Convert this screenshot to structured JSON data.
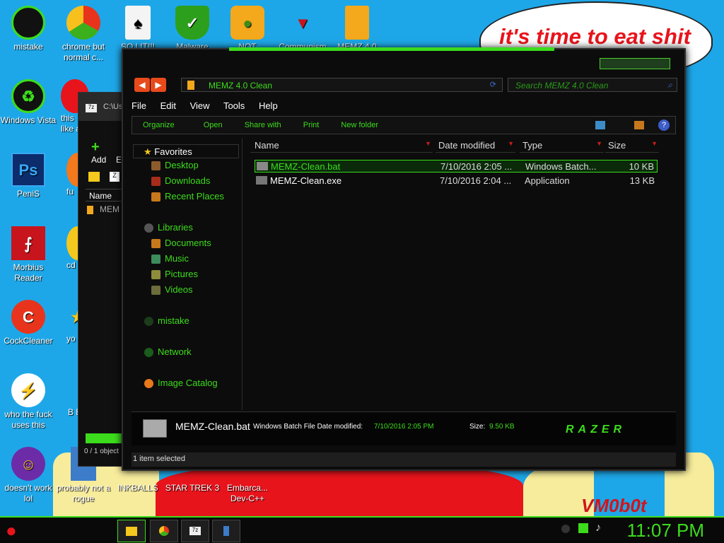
{
  "wallpaper": {
    "bubble_text": "it's time to eat shit",
    "signature": "VM0b0t"
  },
  "desktop_icons": [
    {
      "label": "mistake"
    },
    {
      "label": "chrome but normal c..."
    },
    {
      "label": "SO LIT!!!"
    },
    {
      "label": "Malware"
    },
    {
      "label": "NOT"
    },
    {
      "label": "Communism"
    },
    {
      "label": "MEMZ 4.0"
    },
    {
      "label": "Windows Vista"
    },
    {
      "label": "this like a"
    },
    {
      "label": "PeniS"
    },
    {
      "label": "fu"
    },
    {
      "label": "Morbius Reader"
    },
    {
      "label": "cd"
    },
    {
      "label": "CockCleaner"
    },
    {
      "label": "yo"
    },
    {
      "label": "who the fuck uses this"
    },
    {
      "label": "B B"
    },
    {
      "label": "doesn't work lol"
    },
    {
      "label": "probably not a rogue"
    },
    {
      "label": "INKBALLS"
    },
    {
      "label": "STAR TREK 3"
    },
    {
      "label": "Embarca... Dev-C++"
    }
  ],
  "back_window": {
    "title": "C:\\Use",
    "add_label": "Add",
    "ex_label": "Ex",
    "name_col": "Name",
    "file_item": "MEM",
    "status": "0 / 1 object"
  },
  "explorer": {
    "address": "MEMZ 4.0 Clean",
    "search_placeholder": "Search MEMZ 4.0 Clean",
    "menu": [
      "File",
      "Edit",
      "View",
      "Tools",
      "Help"
    ],
    "commands": [
      "Organize",
      "Open",
      "Share with",
      "Print",
      "New folder"
    ],
    "sidebar": {
      "favorites": "Favorites",
      "fav_items": [
        "Desktop",
        "Downloads",
        "Recent Places"
      ],
      "libraries": "Libraries",
      "lib_items": [
        "Documents",
        "Music",
        "Pictures",
        "Videos"
      ],
      "user": "mistake",
      "network": "Network",
      "catalog": "Image Catalog"
    },
    "columns": [
      "Name",
      "Date modified",
      "Type",
      "Size"
    ],
    "files": [
      {
        "name": "MEMZ-Clean.bat",
        "date": "7/10/2016 2:05 ...",
        "type": "Windows Batch...",
        "size": "10 KB"
      },
      {
        "name": "MEMZ-Clean.exe",
        "date": "7/10/2016 2:04 ...",
        "type": "Application",
        "size": "13 KB"
      }
    ],
    "details": {
      "filename": "MEMZ-Clean.bat",
      "type_text": "Windows Batch File Date modified:",
      "date_value": "7/10/2016 2:05 PM",
      "size_label": "Size:",
      "size_value": "9.50 KB",
      "logo": "RAZER"
    },
    "status": "1 item selected"
  },
  "taskbar": {
    "clock": "11:07 PM"
  },
  "colors": {
    "accent": "#3cdc1c",
    "desktop": "#1ea7e8",
    "window_bg": "#0c0c0c"
  }
}
